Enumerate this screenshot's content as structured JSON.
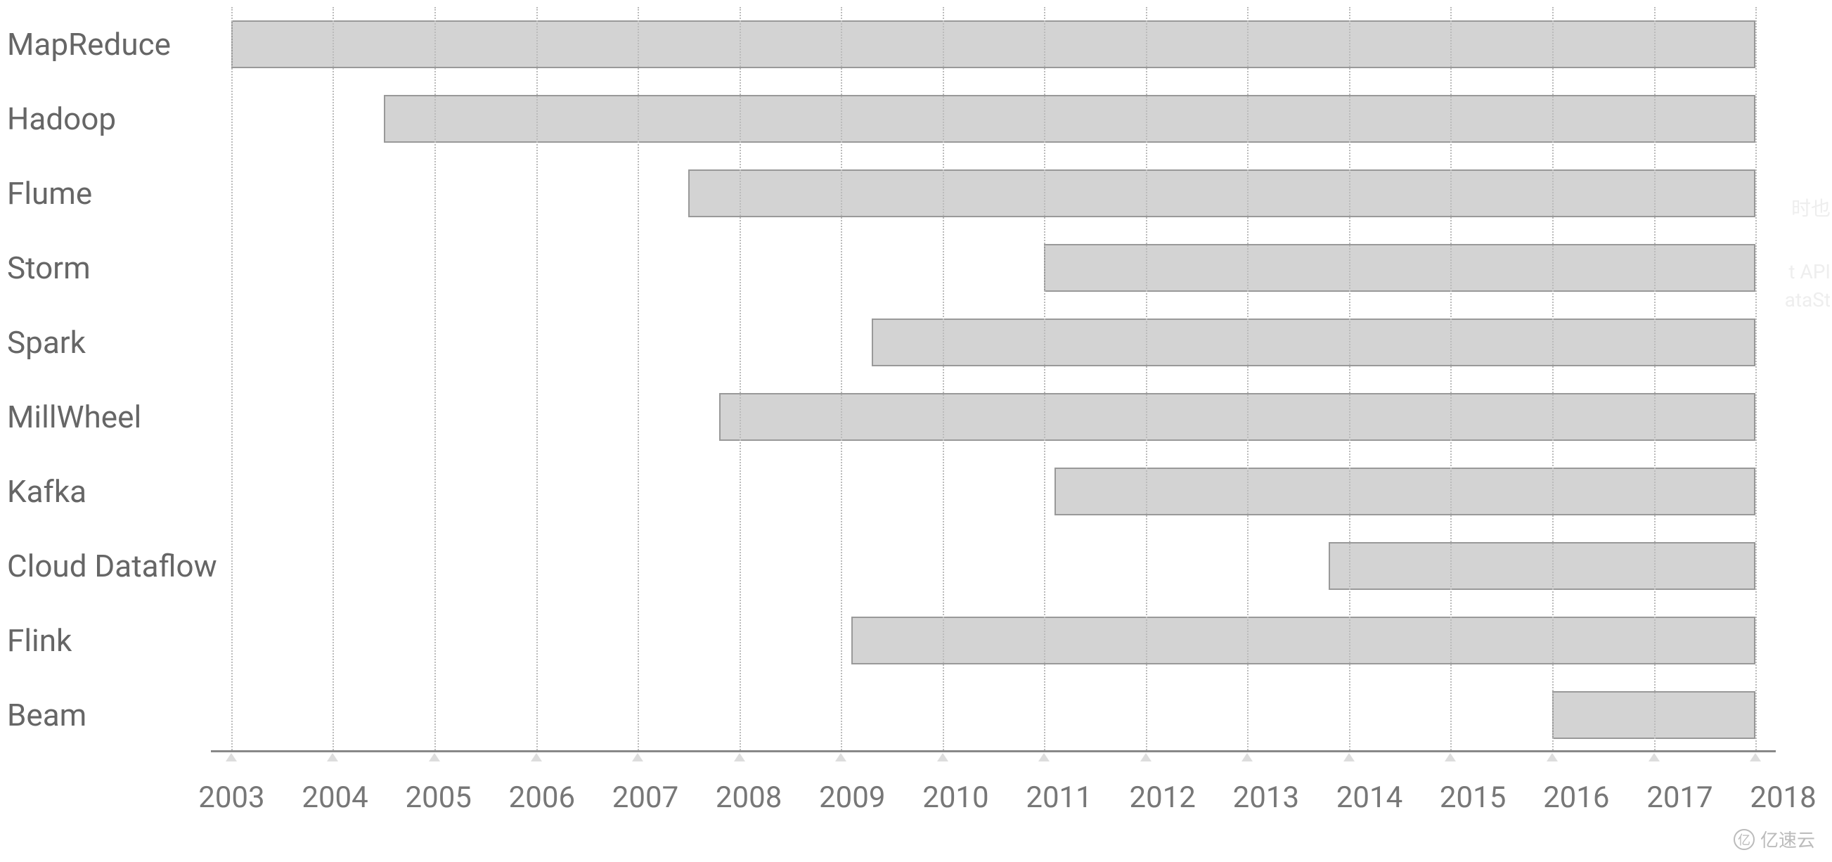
{
  "chart_data": {
    "type": "bar",
    "orientation": "horizontal-gantt",
    "categories": [
      "MapReduce",
      "Hadoop",
      "Flume",
      "Storm",
      "Spark",
      "MillWheel",
      "Kafka",
      "Cloud Dataflow",
      "Flink",
      "Beam"
    ],
    "series": [
      {
        "name": "MapReduce",
        "start": 2003,
        "end": 2018
      },
      {
        "name": "Hadoop",
        "start": 2004.5,
        "end": 2018
      },
      {
        "name": "Flume",
        "start": 2007.5,
        "end": 2018
      },
      {
        "name": "Storm",
        "start": 2011,
        "end": 2018
      },
      {
        "name": "Spark",
        "start": 2009.3,
        "end": 2018
      },
      {
        "name": "MillWheel",
        "start": 2007.8,
        "end": 2018
      },
      {
        "name": "Kafka",
        "start": 2011.1,
        "end": 2018
      },
      {
        "name": "Cloud Dataflow",
        "start": 2013.8,
        "end": 2018
      },
      {
        "name": "Flink",
        "start": 2009.1,
        "end": 2018
      },
      {
        "name": "Beam",
        "start": 2016,
        "end": 2018
      }
    ],
    "x_ticks": [
      2003,
      2004,
      2005,
      2006,
      2007,
      2008,
      2009,
      2010,
      2011,
      2012,
      2013,
      2014,
      2015,
      2016,
      2017,
      2018
    ],
    "xlim": [
      2002.8,
      2018.2
    ],
    "title": "",
    "xlabel": "",
    "ylabel": ""
  },
  "watermark": {
    "text": "亿速云",
    "icon_label": "亿"
  },
  "background_text": {
    "t1": "时也",
    "t2": "t API",
    "t3": "ataSt"
  }
}
